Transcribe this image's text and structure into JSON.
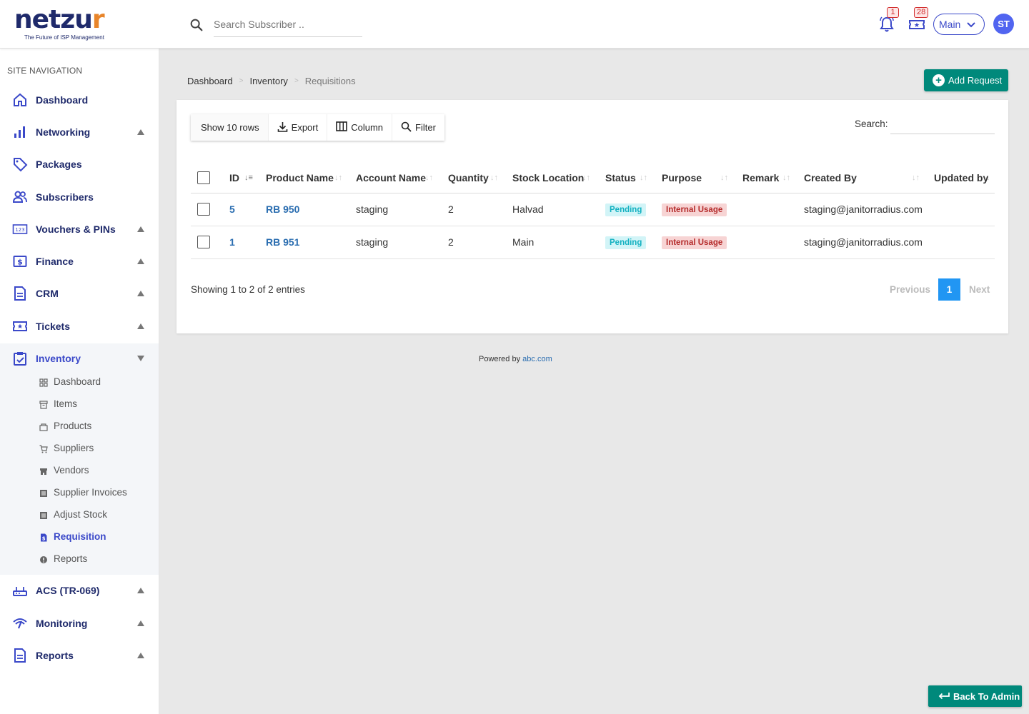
{
  "brand": {
    "logo_main": "netzu",
    "logo_accent": "r",
    "tagline": "The Future of ISP Management",
    "primary_color": "#1f2a6b",
    "accent_color": "#e8852a"
  },
  "header": {
    "search_placeholder": "Search Subscriber ..",
    "notifications_count": "1",
    "tickets_count": "28",
    "branch": "Main",
    "user_initials": "ST"
  },
  "sidebar": {
    "heading": "SITE NAVIGATION",
    "items": [
      {
        "label": "Dashboard",
        "icon": "home-icon",
        "expandable": false
      },
      {
        "label": "Networking",
        "icon": "bar-chart-icon",
        "expandable": true
      },
      {
        "label": "Packages",
        "icon": "tag-icon",
        "expandable": false
      },
      {
        "label": "Subscribers",
        "icon": "users-icon",
        "expandable": false
      },
      {
        "label": "Vouchers & PINs",
        "icon": "pin-icon",
        "expandable": true
      },
      {
        "label": "Finance",
        "icon": "dollar-icon",
        "expandable": true
      },
      {
        "label": "CRM",
        "icon": "document-icon",
        "expandable": true
      },
      {
        "label": "Tickets",
        "icon": "ticket-icon",
        "expandable": true
      },
      {
        "label": "Inventory",
        "icon": "clipboard-check-icon",
        "expandable": true,
        "expanded": true
      },
      {
        "label": "ACS (TR-069)",
        "icon": "router-icon",
        "expandable": true
      },
      {
        "label": "Monitoring",
        "icon": "signal-icon",
        "expandable": true
      },
      {
        "label": "Reports",
        "icon": "report-icon",
        "expandable": true
      }
    ],
    "inventory_sub": [
      {
        "label": "Dashboard",
        "icon": "grid-icon"
      },
      {
        "label": "Items",
        "icon": "archive-icon"
      },
      {
        "label": "Products",
        "icon": "products-icon"
      },
      {
        "label": "Suppliers",
        "icon": "cart-icon"
      },
      {
        "label": "Vendors",
        "icon": "store-icon"
      },
      {
        "label": "Supplier Invoices",
        "icon": "list-icon"
      },
      {
        "label": "Adjust Stock",
        "icon": "list-icon"
      },
      {
        "label": "Requisition",
        "icon": "file-icon",
        "active": true
      },
      {
        "label": "Reports",
        "icon": "info-icon"
      }
    ]
  },
  "breadcrumb": [
    "Dashboard",
    "Inventory",
    "Requisitions"
  ],
  "actions": {
    "add_request": "Add Request",
    "back_to_admin": "Back To Admin"
  },
  "toolbar": {
    "show_rows": "Show 10 rows",
    "export": "Export",
    "column": "Column",
    "filter": "Filter",
    "search_label": "Search:"
  },
  "table": {
    "columns": [
      "ID",
      "Product Name",
      "Account Name",
      "Quantity",
      "Stock Location",
      "Status",
      "Purpose",
      "Remark",
      "Created By",
      "Updated by"
    ],
    "rows": [
      {
        "id": "5",
        "product": "RB 950",
        "account": "staging",
        "quantity": "2",
        "location": "Halvad",
        "status": "Pending",
        "purpose": "Internal Usage",
        "remark": "",
        "created_by": "staging@janitorradius.com",
        "updated_by": ""
      },
      {
        "id": "1",
        "product": "RB 951",
        "account": "staging",
        "quantity": "2",
        "location": "Main",
        "status": "Pending",
        "purpose": "Internal Usage",
        "remark": "",
        "created_by": "staging@janitorradius.com",
        "updated_by": ""
      }
    ]
  },
  "pagination": {
    "info": "Showing 1 to 2 of 2 entries",
    "previous": "Previous",
    "current": "1",
    "next": "Next"
  },
  "footer": {
    "powered_by": "Powered by",
    "link": "abc.com"
  }
}
